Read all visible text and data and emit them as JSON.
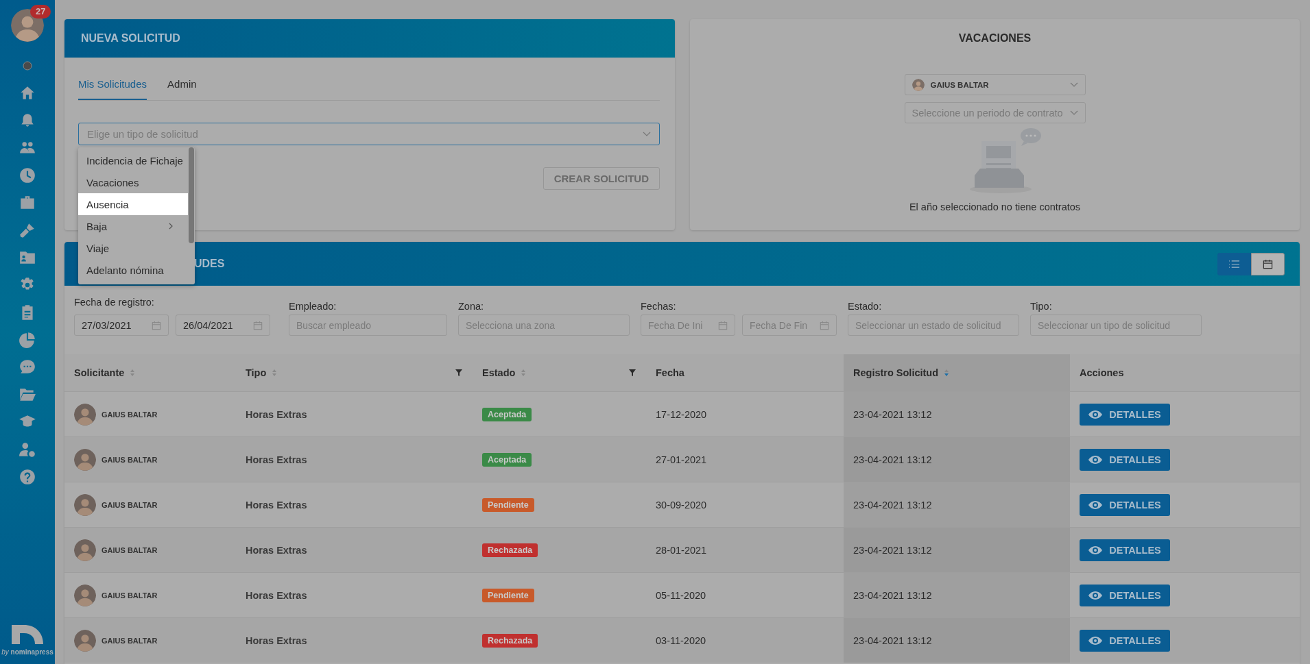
{
  "sidebar": {
    "badge": "27",
    "logo_by": "by",
    "logo_name": "nominapress"
  },
  "new_request": {
    "title": "NUEVA SOLICITUD",
    "tabs": [
      {
        "label": "Mis Solicitudes",
        "selected": true
      },
      {
        "label": "Admin",
        "selected": false
      }
    ],
    "select": {
      "placeholder": "Elige un tipo de solicitud",
      "expanded": true
    },
    "menu": [
      {
        "label": "Incidencia de Fichaje",
        "selected": false,
        "submenu": false
      },
      {
        "label": "Vacaciones",
        "selected": false,
        "submenu": false
      },
      {
        "label": "Ausencia",
        "selected": true,
        "submenu": false
      },
      {
        "label": "Baja",
        "selected": false,
        "submenu": true
      },
      {
        "label": "Viaje",
        "selected": false,
        "submenu": false
      },
      {
        "label": "Adelanto nómina",
        "selected": false,
        "submenu": false
      }
    ],
    "button": {
      "label": "CREAR SOLICITUD",
      "disabled": true
    }
  },
  "vacations": {
    "title": "VACACIONES",
    "employee": "GAIUS BALTAR",
    "period_placeholder": "Seleccione un periodo de contrato",
    "empty_message": "El año seleccionado no tiene contratos"
  },
  "requests": {
    "title": "UDES",
    "views": [
      {
        "kind": "list",
        "selected": true
      },
      {
        "kind": "calendar",
        "selected": false
      }
    ],
    "filters": [
      {
        "label": "Fecha de registro:",
        "fields": [
          {
            "kind": "date",
            "value": "27/03/2021"
          },
          {
            "kind": "date",
            "value": "26/04/2021"
          }
        ]
      },
      {
        "label": "Empleado:",
        "fields": [
          {
            "kind": "text",
            "placeholder": "Buscar empleado"
          }
        ]
      },
      {
        "label": "Zona:",
        "fields": [
          {
            "kind": "text",
            "placeholder": "Selecciona una zona"
          }
        ]
      },
      {
        "label": "Fechas:",
        "fields": [
          {
            "kind": "date",
            "placeholder": "Fecha De Ini"
          },
          {
            "kind": "date",
            "placeholder": "Fecha De Fin"
          }
        ]
      },
      {
        "label": "Estado:",
        "fields": [
          {
            "kind": "text",
            "placeholder": "Seleccionar un estado de solicitud"
          }
        ]
      },
      {
        "label": "Tipo:",
        "fields": [
          {
            "kind": "text",
            "placeholder": "Seleccionar un tipo de solicitud"
          }
        ]
      }
    ],
    "columns": [
      {
        "label": "Solicitante",
        "sortable": true,
        "sorted": false,
        "filter": false
      },
      {
        "label": "Tipo",
        "sortable": true,
        "sorted": false,
        "filter": true
      },
      {
        "label": "Estado",
        "sortable": true,
        "sorted": false,
        "filter": true
      },
      {
        "label": "Fecha",
        "sortable": false,
        "filter": false
      },
      {
        "label": "Registro Solicitud",
        "sortable": true,
        "sorted": true,
        "filter": false
      },
      {
        "label": "Acciones",
        "sortable": false,
        "filter": false
      }
    ],
    "rows": [
      {
        "name": "GAIUS BALTAR",
        "type": "Horas Extras",
        "status": "Aceptada",
        "color": "#3a8a47",
        "date": "17-12-2020",
        "registered": "23-04-2021 13:12",
        "action": "DETALLES"
      },
      {
        "name": "GAIUS BALTAR",
        "type": "Horas Extras",
        "status": "Aceptada",
        "color": "#3a8a47",
        "date": "27-01-2021",
        "registered": "23-04-2021 13:12",
        "action": "DETALLES"
      },
      {
        "name": "GAIUS BALTAR",
        "type": "Horas Extras",
        "status": "Pendiente",
        "color": "#c85a2a",
        "date": "30-09-2020",
        "registered": "23-04-2021 13:12",
        "action": "DETALLES"
      },
      {
        "name": "GAIUS BALTAR",
        "type": "Horas Extras",
        "status": "Rechazada",
        "color": "#c0302f",
        "date": "28-01-2021",
        "registered": "23-04-2021 13:12",
        "action": "DETALLES"
      },
      {
        "name": "GAIUS BALTAR",
        "type": "Horas Extras",
        "status": "Pendiente",
        "color": "#c85a2a",
        "date": "05-11-2020",
        "registered": "23-04-2021 13:12",
        "action": "DETALLES"
      },
      {
        "name": "GAIUS BALTAR",
        "type": "Horas Extras",
        "status": "Rechazada",
        "color": "#c0302f",
        "date": "03-11-2020",
        "registered": "23-04-2021 13:12",
        "action": "DETALLES"
      }
    ]
  }
}
